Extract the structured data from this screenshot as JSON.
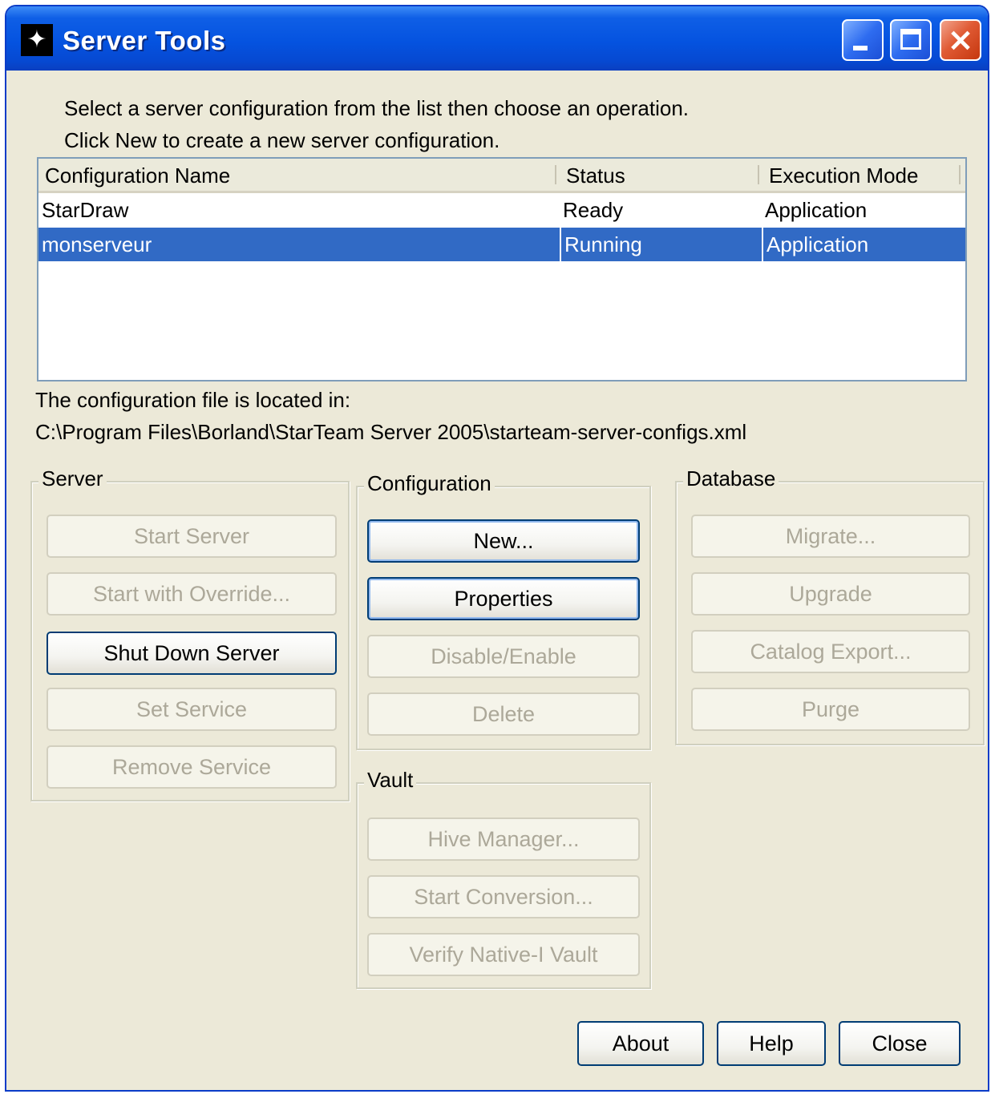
{
  "window": {
    "title": "Server Tools",
    "controls": {
      "minimize": "minimize",
      "maximize": "maximize",
      "close": "×"
    }
  },
  "instructions": {
    "line1": "Select a server configuration from the list then choose an operation.",
    "line2": "Click New to create a new server configuration."
  },
  "table": {
    "columns": [
      "Configuration Name",
      "Status",
      "Execution Mode"
    ],
    "rows": [
      {
        "name": "StarDraw",
        "status": "Ready",
        "mode": "Application",
        "selected": false
      },
      {
        "name": "monserveur",
        "status": "Running",
        "mode": "Application",
        "selected": true
      }
    ]
  },
  "config_file": {
    "label": "The configuration file is located in:",
    "path": "C:\\Program Files\\Borland\\StarTeam Server 2005\\starteam-server-configs.xml"
  },
  "server_group": {
    "legend": "Server",
    "buttons": {
      "start_server": "Start Server",
      "start_override": "Start with Override...",
      "shut_down": "Shut Down Server",
      "set_service": "Set Service",
      "remove_service": "Remove Service"
    }
  },
  "configuration_group": {
    "legend": "Configuration",
    "buttons": {
      "new": "New...",
      "properties": "Properties",
      "disable_enable": "Disable/Enable",
      "delete": "Delete"
    }
  },
  "vault_group": {
    "legend": "Vault",
    "buttons": {
      "hive_manager": "Hive Manager...",
      "start_conversion": "Start Conversion...",
      "verify_native": "Verify Native-I Vault"
    }
  },
  "database_group": {
    "legend": "Database",
    "buttons": {
      "migrate": "Migrate...",
      "upgrade": "Upgrade",
      "catalog_export": "Catalog Export...",
      "purge": "Purge"
    }
  },
  "footer": {
    "about": "About",
    "help": "Help",
    "close": "Close"
  },
  "colors": {
    "titlebar": "#0553e0",
    "selection": "#316ac5",
    "dialog_bg": "#ece9d8",
    "disabled_text": "#aca899"
  }
}
